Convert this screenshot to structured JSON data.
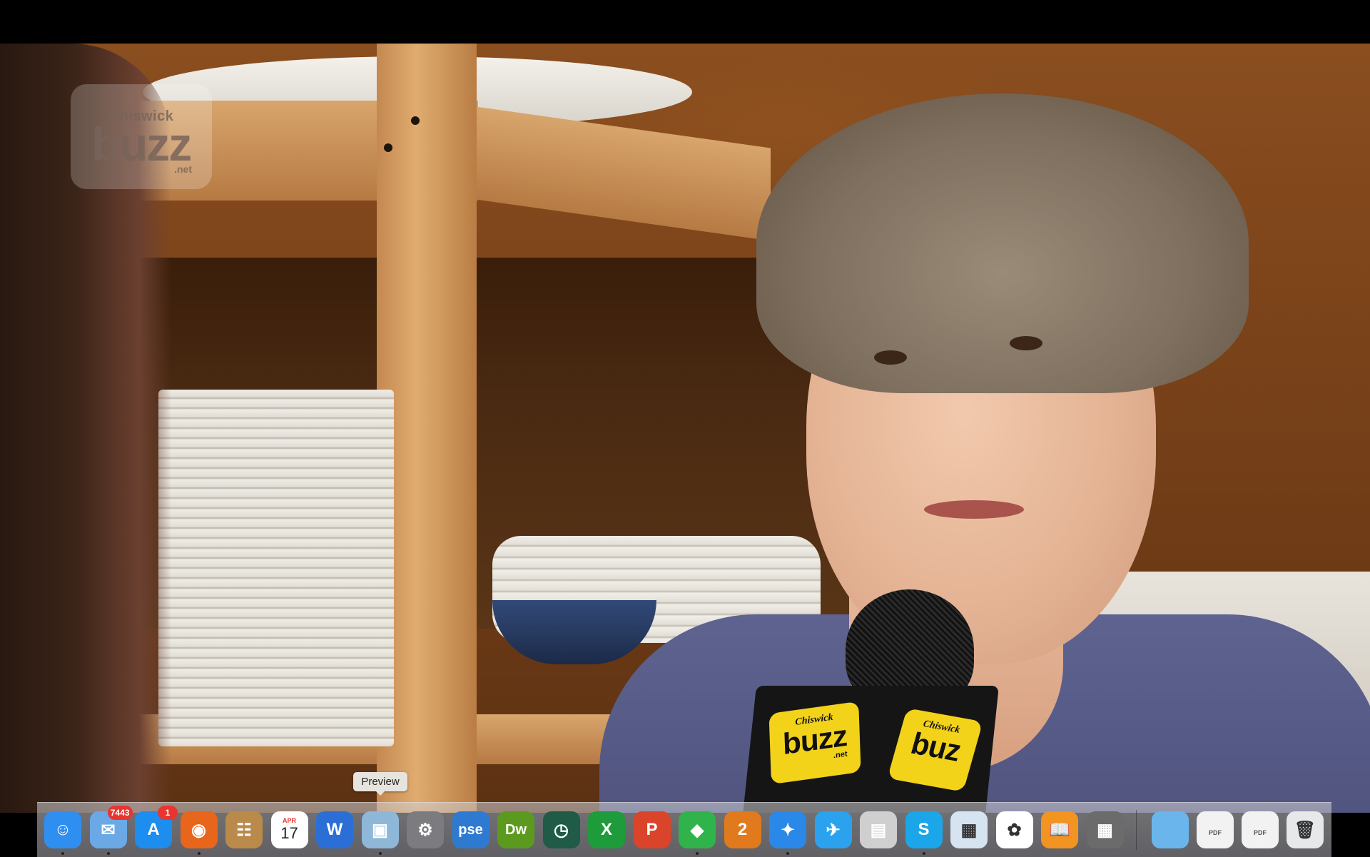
{
  "video": {
    "watermark": {
      "line1": "Chiswick",
      "line2": "buzz",
      "line3": ".net"
    },
    "mic_flag": {
      "line1": "Chiswick",
      "line2": "buzz",
      "line3": ".net",
      "line2_partial": "buz"
    }
  },
  "dock": {
    "tooltip": "Preview",
    "apps": [
      {
        "name": "Finder",
        "icon": "finder-icon",
        "color": "#2f8ff0",
        "glyph": "☺",
        "running": true
      },
      {
        "name": "Mail",
        "icon": "mail-icon",
        "color": "#6aa9e6",
        "glyph": "✉",
        "badge": "7443",
        "running": true
      },
      {
        "name": "App Store",
        "icon": "app-store-icon",
        "color": "#1d8df0",
        "glyph": "A",
        "badge": "1"
      },
      {
        "name": "Firefox",
        "icon": "firefox-icon",
        "color": "#e8651c",
        "glyph": "◉",
        "running": true
      },
      {
        "name": "Contacts",
        "icon": "contacts-icon",
        "color": "#b98a4a",
        "glyph": "☷"
      },
      {
        "name": "Calendar",
        "icon": "calendar-icon",
        "color": "#ffffff",
        "month": "APR",
        "day": "17"
      },
      {
        "name": "Word",
        "icon": "word-icon",
        "color": "#2b6fd6",
        "glyph": "W"
      },
      {
        "name": "Preview",
        "icon": "preview-icon",
        "color": "#8fb7d8",
        "glyph": "▣",
        "running": true
      },
      {
        "name": "System Preferences",
        "icon": "gear-icon",
        "color": "#7c7c80",
        "glyph": "⚙"
      },
      {
        "name": "Photoshop Elements",
        "icon": "pse-icon",
        "color": "#2f7ad1",
        "glyph": "pse"
      },
      {
        "name": "Dreamweaver",
        "icon": "dreamweaver-icon",
        "color": "#5c9a1f",
        "glyph": "Dw"
      },
      {
        "name": "Time Machine",
        "icon": "time-machine-icon",
        "color": "#1f5b46",
        "glyph": "◷"
      },
      {
        "name": "Excel",
        "icon": "excel-icon",
        "color": "#1e9b3a",
        "glyph": "X"
      },
      {
        "name": "PowerPoint",
        "icon": "powerpoint-icon",
        "color": "#d9442a",
        "glyph": "P"
      },
      {
        "name": "The Sims",
        "icon": "sims-icon",
        "color": "#2fb34a",
        "glyph": "◆",
        "running": true
      },
      {
        "name": "Sims 2",
        "icon": "sims2-icon",
        "color": "#e07a1c",
        "glyph": "2"
      },
      {
        "name": "Safari",
        "icon": "safari-icon",
        "color": "#2a88e8",
        "glyph": "✦",
        "running": true
      },
      {
        "name": "Twitter",
        "icon": "twitter-icon",
        "color": "#2aa2ee",
        "glyph": "✈"
      },
      {
        "name": "Script Editor",
        "icon": "toaster-icon",
        "color": "#cfcfcf",
        "glyph": "▤"
      },
      {
        "name": "Skype",
        "icon": "skype-icon",
        "color": "#1aa6e8",
        "glyph": "S",
        "running": true
      },
      {
        "name": "Preview Viewer",
        "icon": "image-viewer-icon",
        "color": "#d6e4f2",
        "glyph": "▦"
      },
      {
        "name": "Photos",
        "icon": "photos-icon",
        "color": "#ffffff",
        "glyph": "✿"
      },
      {
        "name": "iBooks",
        "icon": "ibooks-icon",
        "color": "#f29421",
        "glyph": "📖"
      },
      {
        "name": "Calculator",
        "icon": "calculator-icon",
        "color": "#6b6b6b",
        "glyph": "▦"
      }
    ],
    "right_items": [
      {
        "name": "Folder",
        "icon": "folder-icon",
        "color": "#6ab6ec",
        "glyph": ""
      },
      {
        "name": "PDF",
        "icon": "pdf-document-icon",
        "color": "#f2f2f2",
        "label": "PDF"
      },
      {
        "name": "PDF",
        "icon": "pdf-document-icon",
        "color": "#f2f2f2",
        "label": "PDF"
      },
      {
        "name": "Trash",
        "icon": "trash-icon",
        "color": "#e6e8ea",
        "glyph": "🗑"
      }
    ]
  }
}
